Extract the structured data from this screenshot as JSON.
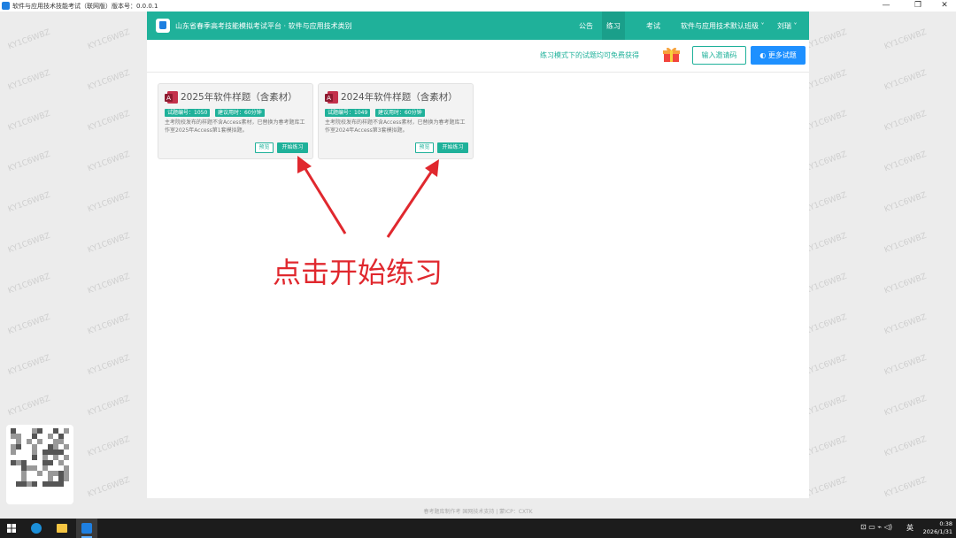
{
  "window": {
    "title": "软件与应用技术技能考试（联网版）",
    "version": "版本号：0.0.0.1",
    "min": "—",
    "max": "❐",
    "close": "✕"
  },
  "watermark": "KY1C6WBZ",
  "navbar": {
    "site_title": "山东省春季高考技能模拟考试平台 · 软件与应用技术类别",
    "items": [
      "公告",
      "练习",
      "考试",
      "软件与应用技术默认班级 ˅",
      "刘瑞 ˅"
    ],
    "active": "练习"
  },
  "subbar": {
    "hint": "练习模式下的试题均可免费获得",
    "invite_label": "输入邀请码",
    "more_label": "◐ 更多试题"
  },
  "cards": [
    {
      "title": "2025年软件样题（含素材）",
      "tag_id": "试题编号：1050",
      "tag_time": "建议用时：60分钟",
      "desc": "主考院校发布的样题不含Access素材，已替换为春考题库工作室2025年Access第1套模拟题。",
      "preview_label": "预览",
      "start_label": "开始练习"
    },
    {
      "title": "2024年软件样题（含素材）",
      "tag_id": "试题编号：1049",
      "tag_time": "建议用时：60分钟",
      "desc": "主考院校发布的样题不含Access素材，已替换为春考题库工作室2024年Access第3套模拟题。",
      "preview_label": "预览",
      "start_label": "开始练习"
    }
  ],
  "annotation": "点击开始练习",
  "footer": "春考题库制作考 国网技术支持 | 蒙ICP：CXTK",
  "taskbar": {
    "tray_lang": "英",
    "tray_icons": "⊡ ▭ ⌁ ◁)",
    "time": "0:38",
    "date": "2026/1/31"
  },
  "colors": {
    "primary": "#1fb19a",
    "blue": "#1e90ff",
    "annotation": "#e0282e"
  }
}
